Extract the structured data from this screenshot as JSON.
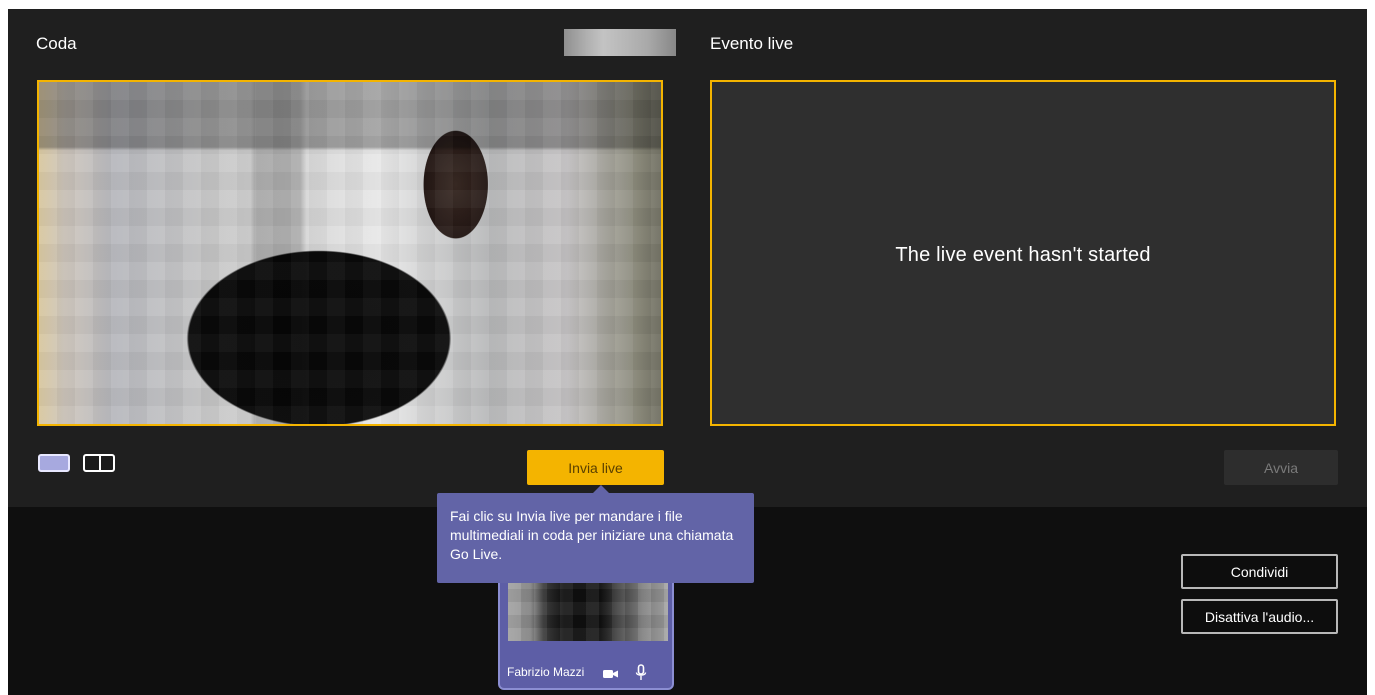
{
  "queue": {
    "title": "Coda"
  },
  "live": {
    "title": "Evento live",
    "status": "The live event hasn't started"
  },
  "controls": {
    "send_live": "Invia live",
    "start": "Avvia",
    "share": "Condividi",
    "mute": "Disattiva l'audio..."
  },
  "tooltip": {
    "text": "Fai clic su Invia live per mandare i file multimediali in coda per iniziare una chiamata Go Live."
  },
  "participant": {
    "name": "Fabrizio Mazzi"
  },
  "icons": {
    "layout_single": "single-layout-icon",
    "layout_split": "split-layout-icon",
    "camera": "camera-icon",
    "microphone": "microphone-icon"
  },
  "colors": {
    "accent": "#f4b400",
    "tooltip": "#6264a7",
    "background": "#1f1f1f",
    "bottom_bar": "#0f0f0f",
    "participant_tile": "#5d5ea6"
  }
}
